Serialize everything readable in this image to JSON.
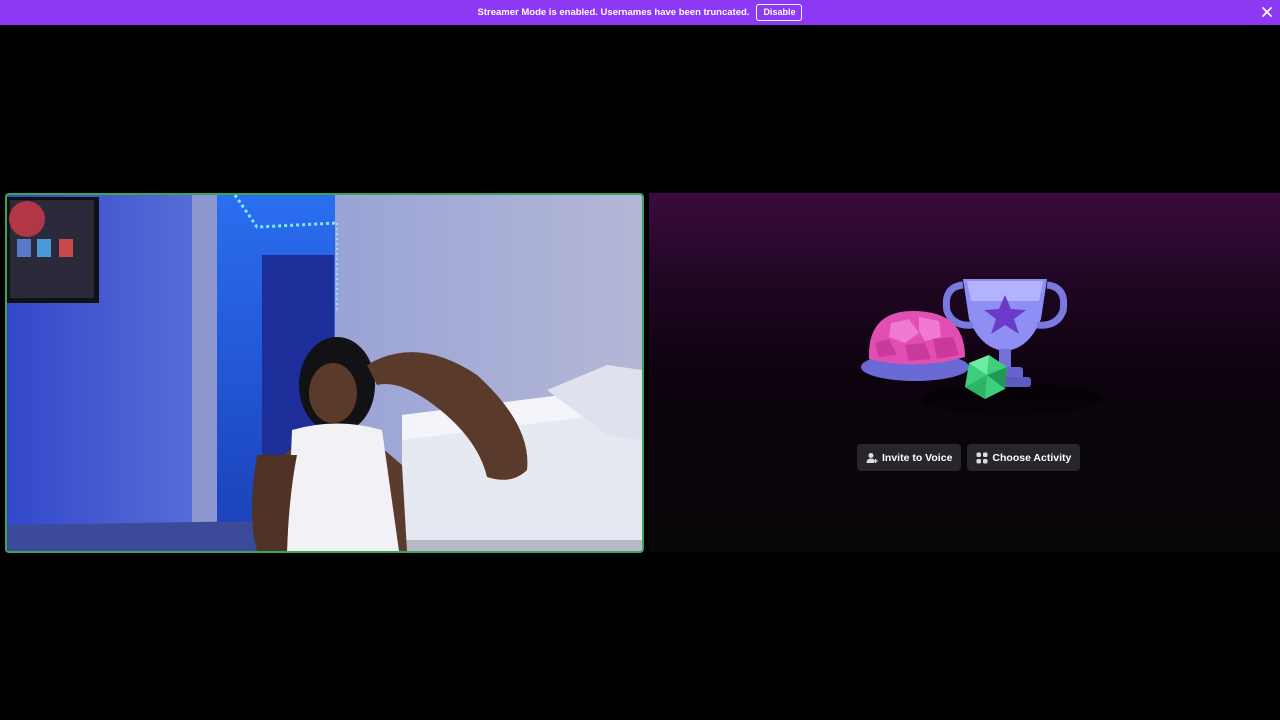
{
  "banner": {
    "message": "Streamer Mode is enabled. Usernames have been truncated.",
    "disable_label": "Disable",
    "close_icon": "close-icon",
    "color": "#8d38f3"
  },
  "video": {
    "speaking_border_color": "#3ba55d"
  },
  "activity": {
    "invite_label": "Invite to Voice",
    "invite_icon": "add-person-icon",
    "choose_label": "Choose Activity",
    "choose_icon": "activities-grid-icon"
  }
}
